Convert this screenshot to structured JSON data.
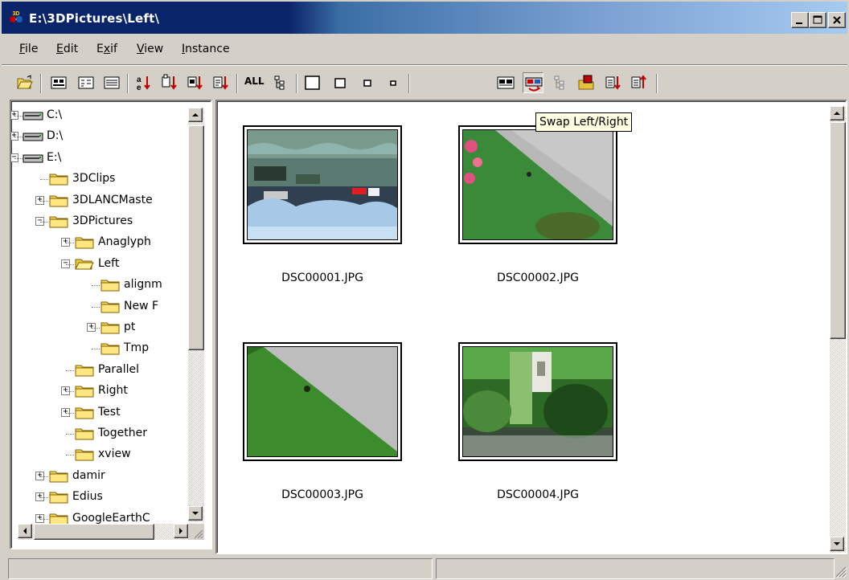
{
  "window": {
    "title": "E:\\3DPictures\\Left\\",
    "accent": "#0a246a",
    "icon": "3d-glasses-icon"
  },
  "menu": {
    "file": {
      "ul": "F",
      "rest": "ile"
    },
    "edit": {
      "ul": "E",
      "rest": "dit"
    },
    "exif": {
      "pre": "E",
      "ul": "x",
      "rest": "if"
    },
    "view": {
      "ul": "V",
      "rest": "iew"
    },
    "instance": {
      "ul": "I",
      "rest": "nstance"
    }
  },
  "toolbar": {
    "all_label": "ALL",
    "tooltip": "Swap Left/Right"
  },
  "tree": [
    {
      "label": "C:\\",
      "icon": "drive-icon",
      "expander": "+"
    },
    {
      "label": "D:\\",
      "icon": "drive-icon",
      "expander": "+"
    },
    {
      "label": "E:\\",
      "icon": "drive-icon",
      "expander": "−"
    },
    {
      "label": "3DClips",
      "icon": "folder-icon",
      "expander": ""
    },
    {
      "label": "3DLANCMaste",
      "icon": "folder-icon",
      "expander": "+"
    },
    {
      "label": "3DPictures",
      "icon": "folder-icon",
      "expander": "−"
    },
    {
      "label": "Anaglyph",
      "icon": "folder-icon",
      "expander": "+"
    },
    {
      "label": "Left",
      "icon": "open-folder-icon",
      "expander": "−",
      "selected": true
    },
    {
      "label": "alignm",
      "icon": "folder-icon",
      "expander": ""
    },
    {
      "label": "New F",
      "icon": "folder-icon",
      "expander": ""
    },
    {
      "label": "pt",
      "icon": "folder-icon",
      "expander": "+"
    },
    {
      "label": "Tmp",
      "icon": "folder-icon",
      "expander": ""
    },
    {
      "label": "Parallel",
      "icon": "folder-icon",
      "expander": ""
    },
    {
      "label": "Right",
      "icon": "folder-icon",
      "expander": "+"
    },
    {
      "label": "Test",
      "icon": "folder-icon",
      "expander": "+"
    },
    {
      "label": "Together",
      "icon": "folder-icon",
      "expander": ""
    },
    {
      "label": "xview",
      "icon": "folder-icon",
      "expander": ""
    },
    {
      "label": "damir",
      "icon": "folder-icon",
      "expander": "+"
    },
    {
      "label": "Edius",
      "icon": "folder-icon",
      "expander": "+"
    },
    {
      "label": "GoogleEarthC",
      "icon": "folder-icon",
      "expander": "+"
    }
  ],
  "thumbnails": [
    {
      "name": "DSC00001.JPG"
    },
    {
      "name": "DSC00002.JPG"
    },
    {
      "name": "DSC00003.JPG"
    },
    {
      "name": "DSC00004.JPG"
    }
  ],
  "status": {
    "left": "",
    "right": ""
  }
}
